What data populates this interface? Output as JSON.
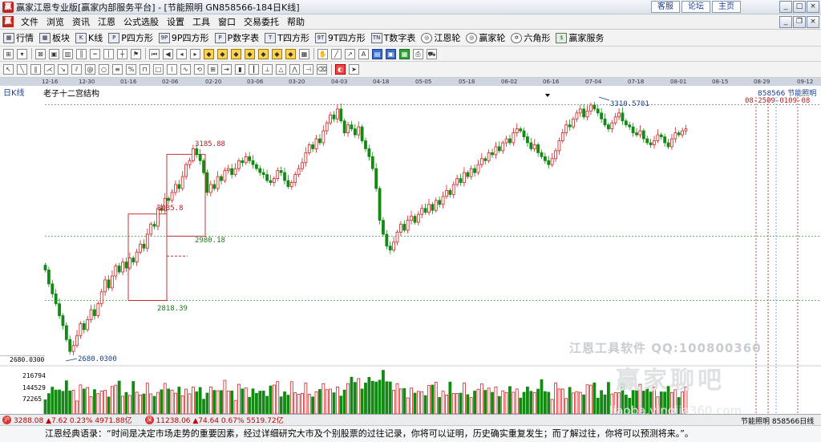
{
  "window": {
    "title": "赢家江恩专业版[赢家内部服务平台] - [节能照明  GN858566-184日K线]",
    "links": [
      "客服",
      "论坛",
      "主页"
    ],
    "logo_text": "赢"
  },
  "menu": [
    "文件",
    "浏览",
    "资讯",
    "江恩",
    "公式选股",
    "设置",
    "工具",
    "窗口",
    "交易委托",
    "帮助"
  ],
  "toolbar1": [
    {
      "icon": "market-icon",
      "glyph": "▦",
      "label": "行情"
    },
    {
      "icon": "sector-icon",
      "glyph": "▦",
      "label": "板块"
    },
    {
      "icon": "kline-icon",
      "glyph": "K",
      "label": "K线"
    },
    {
      "icon": "p-square-icon",
      "glyph": "P",
      "label": "P四方形"
    },
    {
      "icon": "9p-square-icon",
      "glyph": "9P",
      "label": "9P四方形"
    },
    {
      "icon": "p-number-icon",
      "glyph": "P",
      "label": "P数字表"
    },
    {
      "icon": "t-square-icon",
      "glyph": "T",
      "label": "T四方形"
    },
    {
      "icon": "9t-square-icon",
      "glyph": "9T",
      "label": "9T四方形"
    },
    {
      "icon": "t-number-icon",
      "glyph": "TN",
      "label": "T数字表"
    },
    {
      "icon": "gann-wheel-icon",
      "glyph": "◎",
      "label": "江恩轮"
    },
    {
      "icon": "winner-wheel-icon",
      "glyph": "◎",
      "label": "赢家轮"
    },
    {
      "icon": "hexagon-icon",
      "glyph": "✡",
      "label": "六角形"
    },
    {
      "icon": "winner-service-icon",
      "glyph": "$",
      "label": "赢家服务"
    }
  ],
  "chart": {
    "period_label": "日K线",
    "study_name": "老子十二宫结构",
    "code_name": "858566  节能照明",
    "low_axis_value": "2680.0300",
    "future_dates": "08-2509-0109-08",
    "annotations": {
      "high_3185": "3185.88",
      "mid_3035": "3035.8",
      "low_2980": "2980.18",
      "low_2818": "2818.39",
      "swing_low": "2680.0300",
      "swing_high": "3310.5701"
    },
    "volume_axis": [
      "216794",
      "144529",
      "72265"
    ],
    "watermark": {
      "line1": "江恩工具软件  QQ:100800360",
      "line2": "赢家聊吧",
      "line3": "liaoba.yingjia360.com"
    },
    "date_ticks": [
      "12-16",
      "12-30",
      "01-16",
      "02-06",
      "02-20",
      "03-06",
      "03-20",
      "04-03",
      "04-18",
      "05-05",
      "05-18",
      "06-02",
      "06-16",
      "07-04",
      "07-18",
      "08-01",
      "08-15",
      "08-29",
      "09-12"
    ]
  },
  "chart_data": {
    "type": "candlestick",
    "series_name": "858566 节能照明",
    "price_range": [
      2680.03,
      3330
    ],
    "volume_ticks": [
      72265,
      144529,
      216794
    ],
    "close": [
      2895,
      2860,
      2835,
      2810,
      2780,
      2755,
      2720,
      2690,
      2705,
      2730,
      2760,
      2745,
      2770,
      2795,
      2780,
      2810,
      2840,
      2870,
      2850,
      2880,
      2905,
      2890,
      2915,
      2900,
      2925,
      2915,
      2940,
      2960,
      2950,
      2985,
      3010,
      3005,
      3050,
      3045,
      3075,
      3070,
      3090,
      3110,
      3100,
      3130,
      3160,
      3170,
      3200,
      3185,
      3170,
      3140,
      3090,
      3110,
      3100,
      3130,
      3120,
      3145,
      3150,
      3135,
      3150,
      3170,
      3165,
      3180,
      3170,
      3160,
      3150,
      3140,
      3135,
      3120,
      3115,
      3125,
      3145,
      3140,
      3120,
      3105,
      3115,
      3135,
      3150,
      3165,
      3190,
      3210,
      3200,
      3225,
      3215,
      3245,
      3265,
      3285,
      3275,
      3300,
      3270,
      3240,
      3260,
      3250,
      3235,
      3255,
      3220,
      3200,
      3180,
      3150,
      3100,
      3020,
      2985,
      2955,
      2945,
      2965,
      2990,
      3010,
      2995,
      3020,
      3030,
      3015,
      3035,
      3050,
      3040,
      3060,
      3045,
      3070,
      3060,
      3080,
      3095,
      3085,
      3110,
      3125,
      3115,
      3140,
      3130,
      3150,
      3140,
      3160,
      3175,
      3170,
      3190,
      3185,
      3205,
      3195,
      3215,
      3225,
      3215,
      3240,
      3250,
      3245,
      3230,
      3215,
      3200,
      3210,
      3190,
      3180,
      3170,
      3160,
      3175,
      3195,
      3220,
      3240,
      3260,
      3255,
      3275,
      3290,
      3300,
      3280,
      3295,
      3310,
      3300,
      3290,
      3275,
      3260,
      3250,
      3265,
      3280,
      3290,
      3270,
      3260,
      3255,
      3240,
      3235,
      3245,
      3225,
      3215,
      3210,
      3220,
      3235,
      3230,
      3215,
      3205,
      3225,
      3240,
      3235,
      3245,
      3250
    ],
    "note": "volumes are relative heights read against volume_ticks"
  },
  "status": {
    "index1": "3288.08 ▲7.62 0.23% 4971.88亿",
    "index2": "11238.06 ▲74.64 0.67% 5519.72亿",
    "right_text": "节能照明 858566日线",
    "icon1": "沪",
    "icon2": "深"
  },
  "quote": "江恩经典语录：“时间是决定市场走势的重要因素，经过详细研究大市及个别股票的过往记录，你将可以证明，历史确实重复发生；而了解过往，你将可以预测将来。”。",
  "colors": {
    "up": "#d42020",
    "down": "#138a13",
    "box": "#c43030",
    "ref_line": "#2ea02e",
    "accent": "#1a3f8f"
  }
}
